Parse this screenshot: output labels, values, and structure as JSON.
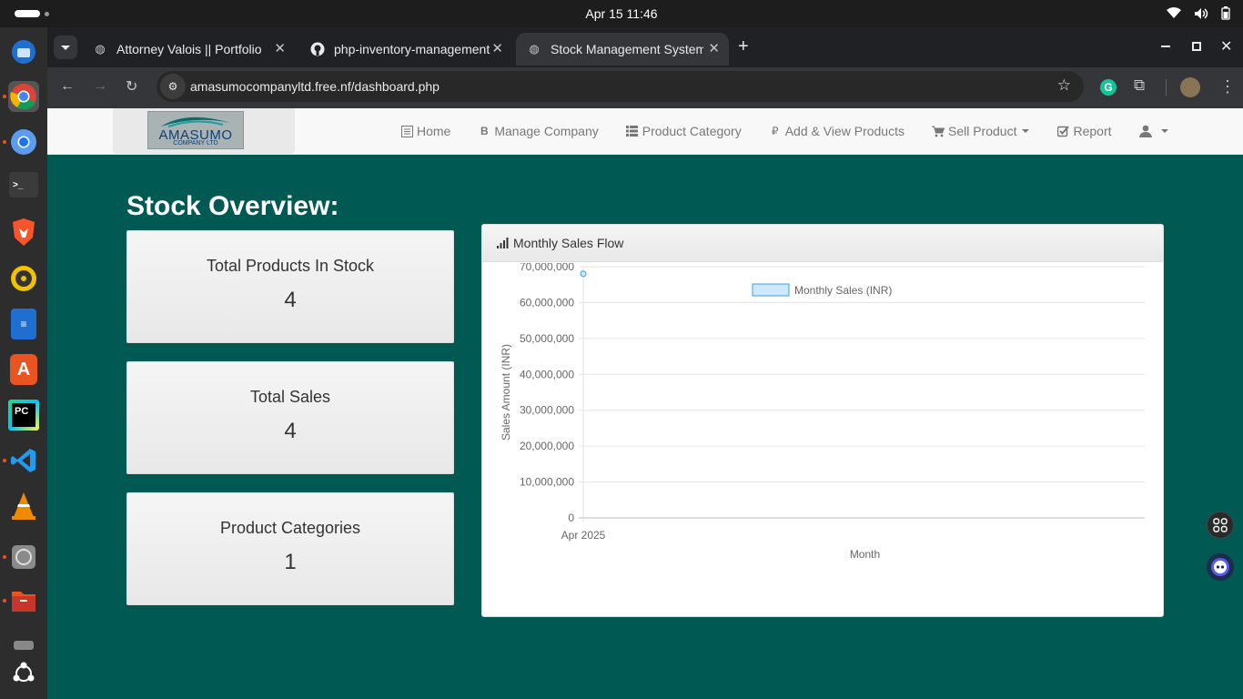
{
  "system": {
    "clock": "Apr 15  11:46"
  },
  "tabs": [
    {
      "title": "Attorney Valois || Portfolio"
    },
    {
      "title": "php-inventory-management"
    },
    {
      "title": "Stock Management System"
    }
  ],
  "address": {
    "url": "amasumocompanyltd.free.nf/dashboard.php"
  },
  "logo": {
    "name": "AMASUMO",
    "sub": "COMPANY LTD"
  },
  "nav": {
    "home": "Home",
    "manage_company": "Manage Company",
    "product_category": "Product Category",
    "add_view_products": "Add & View Products",
    "sell_product": "Sell Product",
    "report": "Report"
  },
  "overview": {
    "heading": "Stock Overview:"
  },
  "cards": [
    {
      "label": "Total Products In Stock",
      "value": "4"
    },
    {
      "label": "Total Sales",
      "value": "4"
    },
    {
      "label": "Product Categories",
      "value": "1"
    }
  ],
  "chart_panel": {
    "title": "Monthly Sales Flow"
  },
  "chart_data": {
    "type": "line",
    "title": "",
    "legend": "Monthly Sales (INR)",
    "legend_position": "top",
    "xlabel": "Month",
    "ylabel": "Sales Amount (INR)",
    "categories": [
      "Apr 2025"
    ],
    "series": [
      {
        "name": "Monthly Sales (INR)",
        "values": [
          68000000
        ]
      }
    ],
    "ylim": [
      0,
      70000000
    ],
    "yticks": [
      0,
      10000000,
      20000000,
      30000000,
      40000000,
      50000000,
      60000000,
      70000000
    ],
    "ytick_labels": [
      "0",
      "10,000,000",
      "20,000,000",
      "30,000,000",
      "40,000,000",
      "50,000,000",
      "60,000,000",
      "70,000,000"
    ],
    "grid": true,
    "colors": {
      "line": "#36a2eb",
      "fill": "#cfe8fb"
    }
  }
}
